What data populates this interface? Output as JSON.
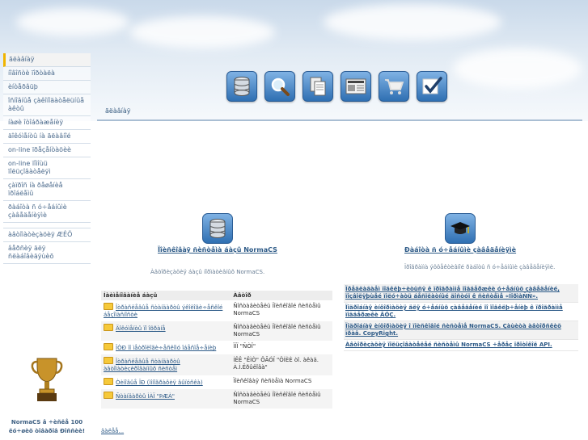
{
  "sidebar": {
    "items": [
      "ãëàâíàÿ",
      "íîâîñòè ïîðòàëà",
      "èíòåðâüþ",
      "îñíîâíûå çàêîíîäàòåëüíûå àêòû",
      "íàøè îòîáðàæåíèÿ",
      "äîêóìåíòû íà ãëàâíîé",
      "on-line ïðåçåíòàöèè",
      "on-line ïîìîùü ïîëüçîâàòåëÿì",
      "çàïðîñ íà ðåøåíèå ïðîáëåìû",
      "ðàáîòà ñ ó÷åáíûìè çàâåäåíèÿìè",
      "àâòîìàòèçàöèÿ ÆÊÕ",
      "âåðñèÿ äëÿ ñëàáîâèäÿùèõ"
    ]
  },
  "toolbar": {
    "icons": [
      "database-icon",
      "search-icon",
      "documents-icon",
      "newspaper-icon",
      "shopping-cart-icon",
      "checkmark-icon"
    ]
  },
  "breadcrumb": "ãëàâíàÿ",
  "left_section": {
    "title": "Ïîèñêîâàÿ ñèñòåìà áàçû NormaCS",
    "desc": "Àâòîðèçàöèÿ áàçû íîðìàòèâíûõ NormaCS.",
    "table": {
      "headers": [
        "Íàèìåíîâàíèå áàçû",
        "Àâòîð"
      ],
      "rows": [
        {
          "name": "Îòðàñëåâûå ñòàíäàðòû ýêîëîãè÷åñêîé áåçîïàñíîñòè",
          "author": "Ñîñòàâèòåëü Ïîèñêîâîé ñèñòåìû NormaCS"
        },
        {
          "name": "Äîêóìåíòû ïî îõðàíå",
          "author": "Ñîñòàâèòåëü Ïîèñêîâîé ñèñòåìû NormaCS"
        },
        {
          "name": "ÏÒÐ ïî ìåòðîëîãè÷åñêîìó îáåñïå÷åíèþ",
          "author": "ÏÏÏ \"ÑÒÎ\""
        },
        {
          "name": "Îòðàñëåâûå ñòàíäàðòû àâòîìàòèçèðîâàííûõ ñèñòåì",
          "author": "ÍÊÊ \"ÊÌÒ\" ÔÃÓÏ \"ÖÍÈÈ òî. àêàä. À.Í.Êðûëîâà\""
        },
        {
          "name": "Òèïîâûå ÏÐ (ìîíîãðàôèÿ âûïóñêà)",
          "author": "Ïîèñêîâàÿ ñèñòåìà NormaCS"
        },
        {
          "name": "Ñòàíäàðòû ÌÀÏ \"ÞÆÀ\"",
          "author": "Ñîñòàâèòåëü Ïîèñêîâîé ñèñòåìû NormaCS"
        }
      ]
    },
    "more": "äàëåå..."
  },
  "right_section": {
    "title": "Ðàáîòà ñ ó÷åáíûìè çàâåäåíèÿìè",
    "desc": "Ïðîãðàììà ýôôåêòèâíîé ðàáîòû ñ ó÷åáíûìè çàâåäåíèÿìè.",
    "links": [
      "Ïðåäëàãàåì ïîäêëþ÷èòüñÿ ê ïðîãðàììå ïîääåðæêè ó÷åáíûõ çàâåäåíèé, ïîçâîëÿþùåé ïîëó÷àòü áåñïëàòíûé äîñòóï ê ñèñòåìå «ÍîðìàÑÑ».",
      "Ïîäðîáíàÿ èíôîðìàöèÿ äëÿ ó÷åáíûõ çàâåäåíèé ïî ïîäêëþ÷åíèþ ê ïðîãðàììå ïîääåðæêè ÂÓÇ.",
      "Ïîäðîáíàÿ èíôîðìàöèÿ î ïîèñêîâîé ñèñòåìå NormaCS. Çàùèòà àâòîðñêèõ ïðàâ. CopyRight.",
      "Àâòîðèçàöèÿ ïîëüçîâàòåëåé ñèñòåìû NormaCS ÷åðåç ïðîòîêîë API."
    ]
  },
  "trophy": {
    "text": "NormaCS â ÷èñëå 100 ëó÷øèõ òîâàðîâ Ðîññèè!"
  },
  "colors": {
    "link": "#2d5a87",
    "active_marker": "#f0b400",
    "icon_blue": "#2f6fb2"
  }
}
